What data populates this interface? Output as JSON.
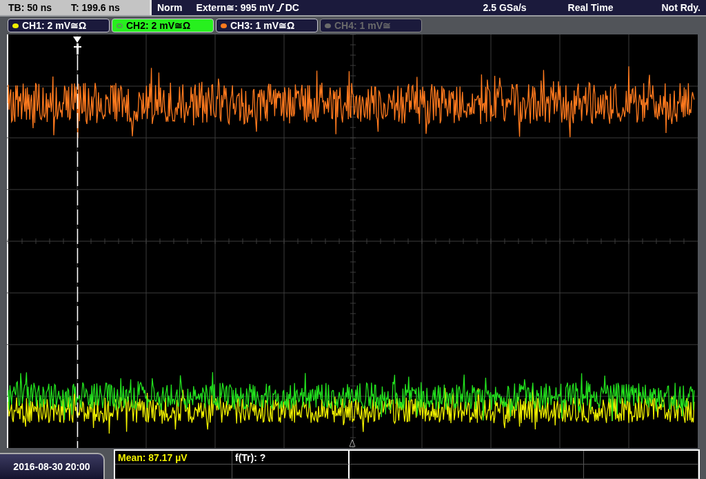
{
  "status_bar": {
    "timebase": "TB: 50 ns",
    "trigger_time": "T: 199.6 ns",
    "trigger_mode": "Norm",
    "trigger_source": "Extern≅: 995 mV",
    "trigger_coupling": "DC",
    "sample_rate": "2.5 GSa/s",
    "acquisition": "Real Time",
    "state": "Not Rdy."
  },
  "channels": [
    {
      "label": "CH1: 2 mV≅Ω",
      "color": "#f0f000",
      "selected": false,
      "enabled": true
    },
    {
      "label": "CH2: 2 mV≅Ω",
      "color": "#22e01e",
      "selected": true,
      "enabled": true
    },
    {
      "label": "CH3: 1 mV≅Ω",
      "color": "#ff7a1e",
      "selected": false,
      "enabled": true
    },
    {
      "label": "CH4: 1 mV≅",
      "color": "#6a6a6a",
      "selected": false,
      "enabled": false
    }
  ],
  "date": "2016-08-30 20:00",
  "measurements": [
    {
      "text": "Mean: 87.17 µV",
      "kind": "measurement"
    },
    {
      "text": "f(Tr): ?",
      "kind": "info"
    }
  ]
}
